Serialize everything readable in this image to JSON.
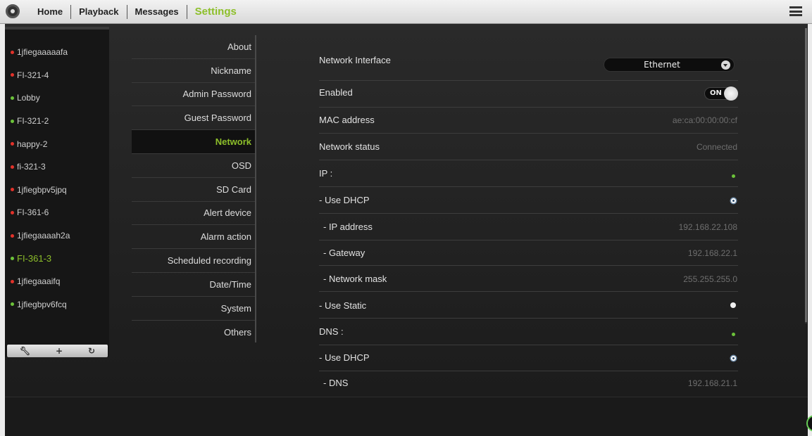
{
  "nav": {
    "items": [
      "Home",
      "Playback",
      "Messages"
    ],
    "active": "Settings"
  },
  "devices": [
    {
      "name": "1jfiegaaaaafa",
      "status": "red"
    },
    {
      "name": "FI-321-4",
      "status": "red"
    },
    {
      "name": "Lobby",
      "status": "green"
    },
    {
      "name": "FI-321-2",
      "status": "green"
    },
    {
      "name": "happy-2",
      "status": "red"
    },
    {
      "name": "fi-321-3",
      "status": "red"
    },
    {
      "name": "1jfiegbpv5jpq",
      "status": "red"
    },
    {
      "name": "FI-361-6",
      "status": "red"
    },
    {
      "name": "1jfiegaaaah2a",
      "status": "red"
    },
    {
      "name": "FI-361-3",
      "status": "green",
      "active": true
    },
    {
      "name": "1jfiegaaaifq",
      "status": "red"
    },
    {
      "name": "1jfiegbpv6fcq",
      "status": "green"
    }
  ],
  "device_toolbar": {
    "wrench_icon": "wrench-icon",
    "add_icon": "plus-icon",
    "refresh_icon": "refresh-icon"
  },
  "settings_menu": [
    "About",
    "Nickname",
    "Admin Password",
    "Guest Password",
    "Network",
    "OSD",
    "SD Card",
    "Alert device",
    "Alarm action",
    "Scheduled recording",
    "Date/Time",
    "System",
    "Others"
  ],
  "settings_active": "Network",
  "network": {
    "interface_label": "Network Interface",
    "interface_value": "Ethernet",
    "enabled_label": "Enabled",
    "enabled_state": "ON",
    "mac_label": "MAC address",
    "mac_value": "ae:ca:00:00:00:cf",
    "status_label": "Network status",
    "status_value": "Connected",
    "ip_header": "IP :",
    "ip_dhcp_label": "- Use DHCP",
    "ip_address_label": "- IP address",
    "ip_address_value": "192.168.22.108",
    "gateway_label": "- Gateway",
    "gateway_value": "192.168.22.1",
    "mask_label": "- Network mask",
    "mask_value": "255.255.255.0",
    "ip_static_label": "- Use Static",
    "dns_header": "DNS :",
    "dns_dhcp_label": "- Use DHCP",
    "dns_label": "- DNS",
    "dns_value": "192.168.21.1"
  },
  "colors": {
    "accent": "#8dbf2a",
    "status_red": "#e2322a",
    "status_green": "#6cc33a"
  }
}
